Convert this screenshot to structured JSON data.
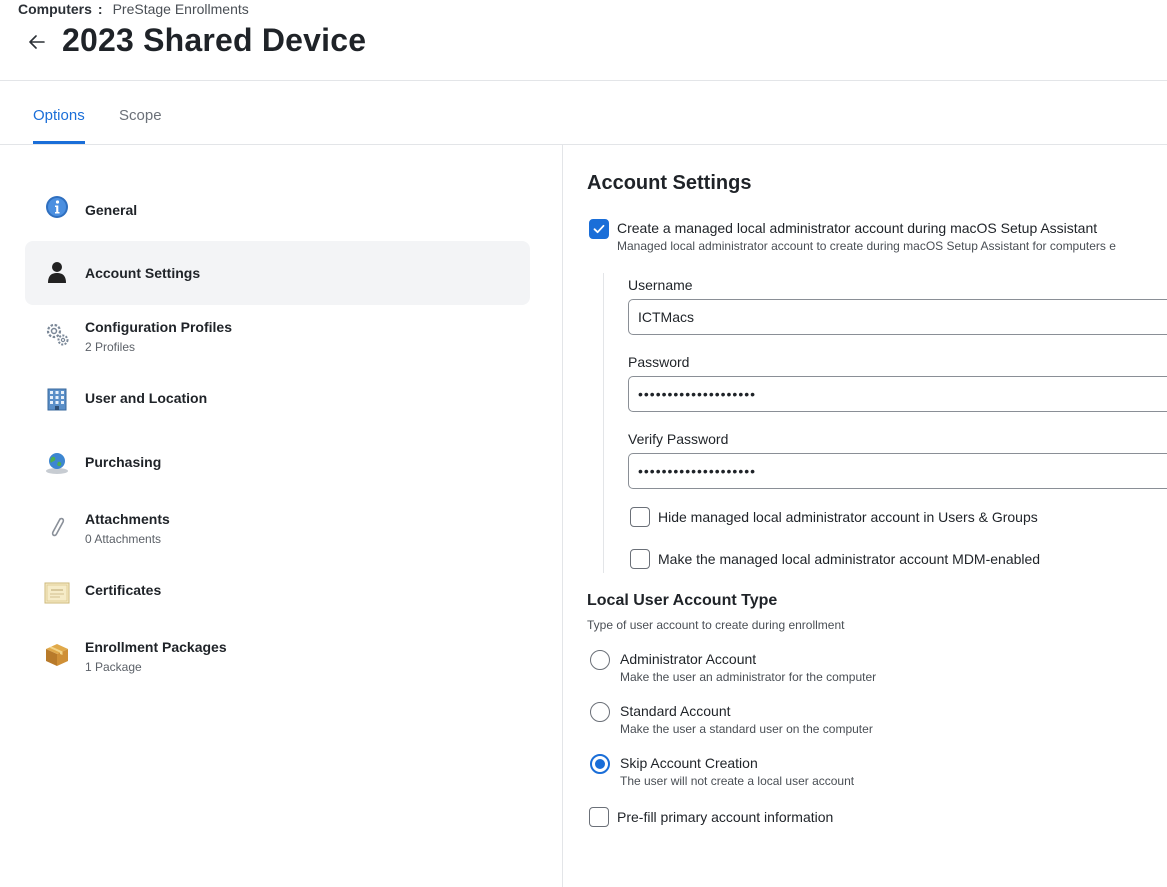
{
  "breadcrumb": {
    "root": "Computers",
    "separator": ":",
    "current": "PreStage Enrollments"
  },
  "page_title": "2023 Shared Device",
  "tabs": [
    {
      "label": "Options",
      "active": true
    },
    {
      "label": "Scope",
      "active": false
    }
  ],
  "sidebar": {
    "items": [
      {
        "label": "General",
        "sub": "",
        "icon": "info-icon"
      },
      {
        "label": "Account Settings",
        "sub": "",
        "icon": "user-silhouette-icon",
        "selected": true
      },
      {
        "label": "Configuration Profiles",
        "sub": "2 Profiles",
        "icon": "gears-icon"
      },
      {
        "label": "User and Location",
        "sub": "",
        "icon": "building-icon"
      },
      {
        "label": "Purchasing",
        "sub": "",
        "icon": "globe-icon"
      },
      {
        "label": "Attachments",
        "sub": "0 Attachments",
        "icon": "paperclip-icon"
      },
      {
        "label": "Certificates",
        "sub": "",
        "icon": "certificate-icon"
      },
      {
        "label": "Enrollment Packages",
        "sub": "1 Package",
        "icon": "package-icon"
      }
    ]
  },
  "account_settings": {
    "title": "Account Settings",
    "create_admin": {
      "checked": true,
      "label": "Create a managed local administrator account during macOS Setup Assistant",
      "description": "Managed local administrator account to create during macOS Setup Assistant for computers e"
    },
    "username": {
      "label": "Username",
      "value": "ICTMacs"
    },
    "password": {
      "label": "Password",
      "value": "••••••••••••••••••••"
    },
    "verify_password": {
      "label": "Verify Password",
      "value": "••••••••••••••••••••"
    },
    "hide_admin": {
      "checked": false,
      "label": "Hide managed local administrator account in Users & Groups"
    },
    "mdm_enabled": {
      "checked": false,
      "label": "Make the managed local administrator account MDM-enabled"
    }
  },
  "local_user_account_type": {
    "title": "Local User Account Type",
    "description": "Type of user account to create during enrollment",
    "options": [
      {
        "label": "Administrator Account",
        "description": "Make the user an administrator for the computer",
        "checked": false
      },
      {
        "label": "Standard Account",
        "description": "Make the user a standard user on the computer",
        "checked": false
      },
      {
        "label": "Skip Account Creation",
        "description": "The user will not create a local user account",
        "checked": true
      }
    ],
    "prefill": {
      "checked": false,
      "label": "Pre-fill primary account information"
    }
  },
  "colors": {
    "accent": "#1a6ed8",
    "border": "#e3e5e8",
    "selected_bg": "#f3f4f6"
  }
}
